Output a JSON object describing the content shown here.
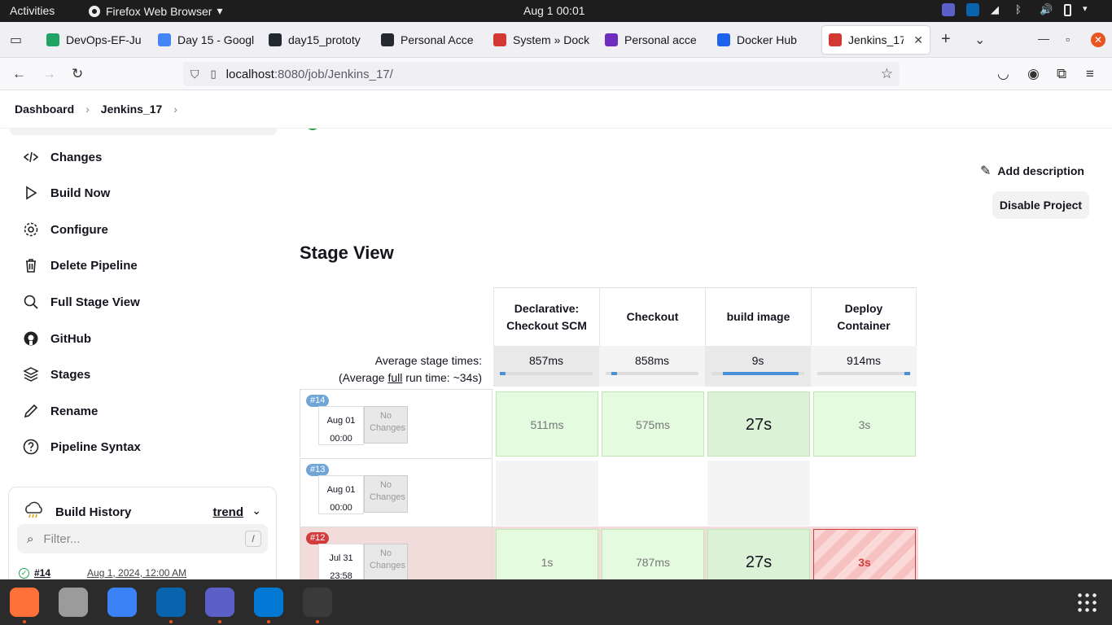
{
  "system": {
    "activities": "Activities",
    "app_menu": "Firefox Web Browser",
    "clock": "Aug 1  00:01"
  },
  "tabs": [
    {
      "label": "DevOps-EF-Ju",
      "icon": "google-drive-icon",
      "color": "#1fa463"
    },
    {
      "label": "Day 15 - Googl",
      "icon": "google-docs-icon",
      "color": "#4285f4"
    },
    {
      "label": "day15_prototy",
      "icon": "github-icon",
      "color": "#24292f"
    },
    {
      "label": "Personal Acce",
      "icon": "github-icon",
      "color": "#24292f"
    },
    {
      "label": "System » Dock",
      "icon": "jenkins-icon",
      "color": "#d33833"
    },
    {
      "label": "Personal acce",
      "icon": "docker-icon",
      "color": "#6f2dbd"
    },
    {
      "label": "Docker Hub",
      "icon": "docker-icon",
      "color": "#1d63ed"
    },
    {
      "label": "Jenkins_17",
      "icon": "jenkins-icon",
      "color": "#d33833",
      "active": true
    }
  ],
  "url": {
    "host": "localhost",
    "path": ":8080/job/Jenkins_17/"
  },
  "breadcrumb": {
    "root": "Dashboard",
    "job": "Jenkins_17"
  },
  "sidebar": {
    "items": [
      {
        "label": "Changes",
        "icon": "code-icon"
      },
      {
        "label": "Build Now",
        "icon": "play-icon"
      },
      {
        "label": "Configure",
        "icon": "gear-icon"
      },
      {
        "label": "Delete Pipeline",
        "icon": "trash-icon"
      },
      {
        "label": "Full Stage View",
        "icon": "search-icon"
      },
      {
        "label": "GitHub",
        "icon": "github-icon"
      },
      {
        "label": "Stages",
        "icon": "layers-icon"
      },
      {
        "label": "Rename",
        "icon": "pencil-icon"
      },
      {
        "label": "Pipeline Syntax",
        "icon": "help-icon"
      }
    ]
  },
  "history": {
    "title": "Build History",
    "trend": "trend",
    "filter_placeholder": "Filter...",
    "filter_shortcut": "/",
    "rows": [
      {
        "build": "#14",
        "date": "Aug 1, 2024, 12:00 AM"
      }
    ]
  },
  "actions": {
    "add_description": "Add description",
    "disable_project": "Disable Project"
  },
  "stage_view": {
    "title": "Stage View",
    "avg_label_line1": "Average stage times:",
    "avg_label_line2_prefix": "(Average ",
    "avg_label_line2_link": "full",
    "avg_label_line2_suffix": " run time: ~34s)",
    "stages": [
      {
        "name": "Declarative: Checkout SCM",
        "avg": "857ms",
        "fill_start": 0.0,
        "fill_end": 0.06
      },
      {
        "name": "Checkout",
        "avg": "858ms",
        "fill_start": 0.06,
        "fill_end": 0.12
      },
      {
        "name": "build image",
        "avg": "9s",
        "fill_start": 0.12,
        "fill_end": 0.94
      },
      {
        "name": "Deploy Container",
        "avg": "914ms",
        "fill_start": 0.94,
        "fill_end": 1.0
      }
    ],
    "runs": [
      {
        "badge": "#14",
        "badge_color": "#6fa6d6",
        "date": "Aug 01",
        "time": "00:00",
        "changes": "No Changes",
        "bg": "#ffffff",
        "cells": [
          {
            "text": "511ms",
            "status": "ok"
          },
          {
            "text": "575ms",
            "status": "ok"
          },
          {
            "text": "27s",
            "status": "ok-big"
          },
          {
            "text": "3s",
            "status": "ok"
          }
        ]
      },
      {
        "badge": "#13",
        "badge_color": "#6fa6d6",
        "date": "Aug 01",
        "time": "00:00",
        "changes": "No Changes",
        "bg": "#ffffff",
        "cells": [
          {
            "text": "",
            "status": "empty"
          },
          {
            "text": "",
            "status": "empty"
          },
          {
            "text": "",
            "status": "empty"
          },
          {
            "text": "",
            "status": "empty"
          }
        ]
      },
      {
        "badge": "#12",
        "badge_color": "#d23c3c",
        "date": "Jul 31",
        "time": "23:58",
        "changes": "No Changes",
        "bg": "#f2dcd9",
        "cells": [
          {
            "text": "1s",
            "status": "ok"
          },
          {
            "text": "787ms",
            "status": "ok"
          },
          {
            "text": "27s",
            "status": "ok-big"
          },
          {
            "text": "3s",
            "status": "fail"
          }
        ]
      }
    ]
  },
  "dock": [
    {
      "name": "firefox-icon",
      "color": "#ff7139"
    },
    {
      "name": "files-icon",
      "color": "#9b9b9b"
    },
    {
      "name": "text-editor-icon",
      "color": "#3b82f6"
    },
    {
      "name": "outlook-icon",
      "color": "#0a64ad"
    },
    {
      "name": "teams-icon",
      "color": "#5b5fc7"
    },
    {
      "name": "vscode-icon",
      "color": "#0078d4"
    },
    {
      "name": "terminal-icon",
      "color": "#3a3a3a"
    }
  ]
}
